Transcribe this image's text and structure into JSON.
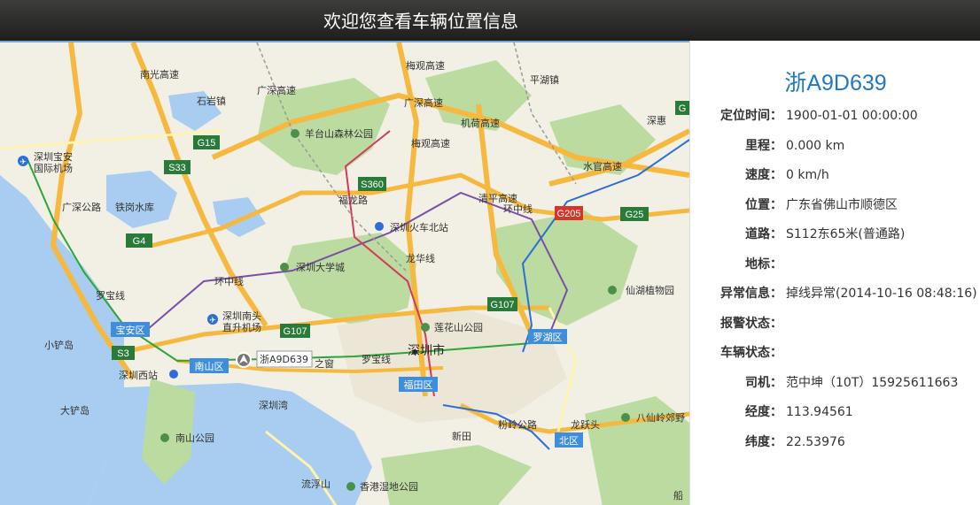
{
  "header": {
    "title": "欢迎您查看车辆位置信息"
  },
  "vehicle": {
    "plate": "浙A9D639",
    "fields": [
      {
        "label": "定位时间：",
        "value": "1900-01-01 00:00:00"
      },
      {
        "label": "里程：",
        "value": "0.000 km"
      },
      {
        "label": "速度：",
        "value": "0 km/h"
      },
      {
        "label": "位置：",
        "value": "广东省佛山市顺德区"
      },
      {
        "label": "道路：",
        "value": "S112东65米(普通路)"
      },
      {
        "label": "地标：",
        "value": ""
      },
      {
        "label": "异常信息：",
        "value": "掉线异常(2014-10-16 08:48:16)"
      },
      {
        "label": "报警状态：",
        "value": ""
      },
      {
        "label": "车辆状态：",
        "value": ""
      },
      {
        "label": "司机：",
        "value": "范中坤（10T）15925611663"
      },
      {
        "label": "经度：",
        "value": "113.94561"
      },
      {
        "label": "纬度：",
        "value": "22.53976"
      }
    ]
  },
  "map": {
    "city_label": "深圳市",
    "vehicle_marker_label": "浙A9D639",
    "district_badges": [
      "宝安区",
      "南山区",
      "福田区",
      "罗湖区",
      "北区"
    ],
    "highway_shields": [
      "G15",
      "S33",
      "G4",
      "S360",
      "G107",
      "G107",
      "S3",
      "G205",
      "G25",
      "G"
    ],
    "place_labels": [
      "石岩镇",
      "平湖镇",
      "深圳宝安",
      "国际机场",
      "铁岗水库",
      "羊台山森林公园",
      "深圳火车北站",
      "深圳大学城",
      "深圳南头",
      "直升机场",
      "莲花山公园",
      "仙湖植物园",
      "小铲岛",
      "深圳西站",
      "大铲岛",
      "深圳湾",
      "南山公园",
      "新田",
      "龙跃头",
      "八仙岭郊野",
      "流浮山",
      "香港湿地公园",
      "之窗",
      "船"
    ],
    "road_labels": [
      "南光高速",
      "广深高速",
      "广深公路",
      "梅观高速",
      "广深高速",
      "机荷高速",
      "梅观高速",
      "清平高速",
      "水官高速",
      "深惠",
      "福龙路",
      "龙华线",
      "环中线",
      "环中线",
      "罗宝线",
      "罗宝线",
      "粉岭公路"
    ]
  }
}
